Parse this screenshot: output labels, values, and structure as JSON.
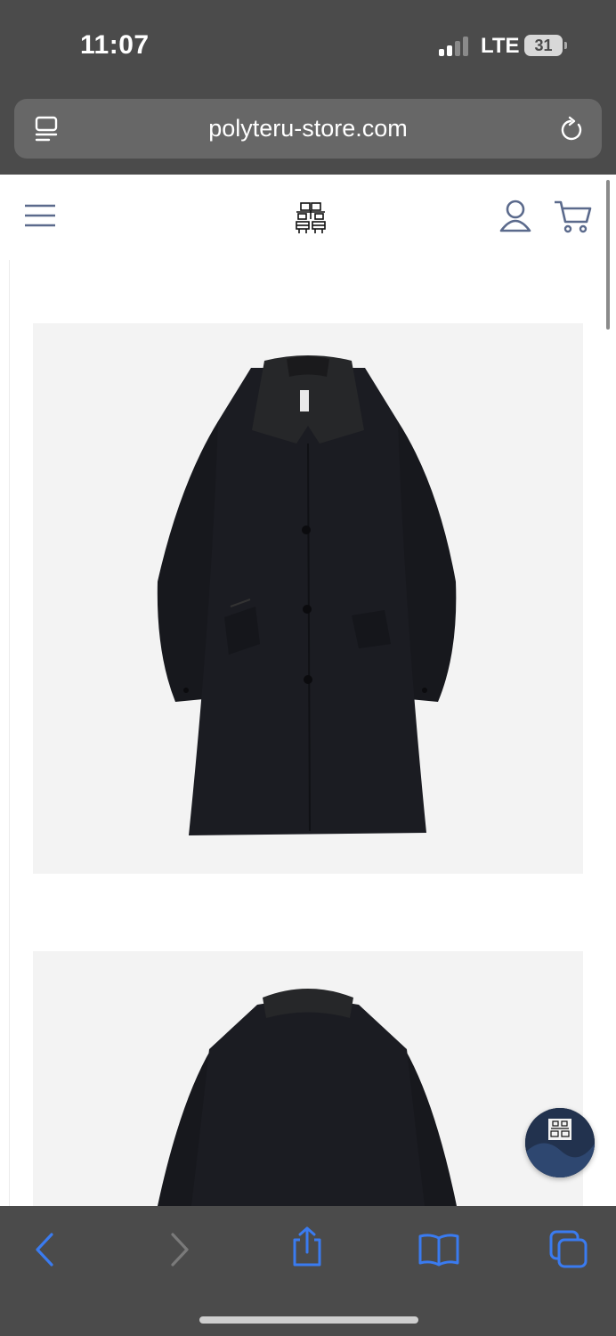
{
  "status_bar": {
    "time": "11:07",
    "network": "LTE",
    "battery": "31"
  },
  "browser": {
    "url": "polyteru-store.com"
  },
  "colors": {
    "chrome": "#4b4b4b",
    "url_field": "#676767",
    "accent_blue": "#3a7bf0",
    "site_icon": "#5b6a8c",
    "image_bg": "#f3f3f3"
  },
  "site_header": {
    "menu_icon": "hamburger-icon",
    "logo_icon": "brand-logo",
    "account_icon": "user-icon",
    "cart_icon": "cart-icon"
  },
  "product_images": [
    {
      "icon": "black-coat-front"
    },
    {
      "icon": "black-coat-back"
    }
  ],
  "toolbar": {
    "back": "chevron-left-icon",
    "forward": "chevron-right-icon",
    "share": "share-icon",
    "bookmarks": "book-icon",
    "tabs": "tabs-icon"
  }
}
